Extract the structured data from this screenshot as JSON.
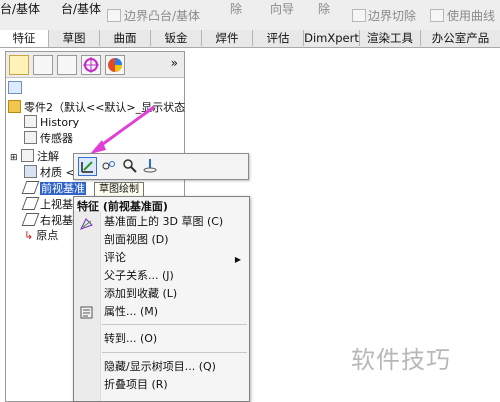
{
  "ribbon": {
    "left_text_1": "台/基体",
    "left_text_2": "台/基体",
    "boss_base": "边界凸台/基体",
    "remove_1": "除",
    "wizard": "向导",
    "remove_2": "除",
    "boundary_cut": "边界切除",
    "use_curve": "使用曲线"
  },
  "tabs": [
    {
      "label": "特征"
    },
    {
      "label": "草图"
    },
    {
      "label": "曲面"
    },
    {
      "label": "钣金"
    },
    {
      "label": "焊件"
    },
    {
      "label": "评估"
    },
    {
      "label": "DimXpert"
    },
    {
      "label": "渲染工具"
    },
    {
      "label": "办公室产品"
    }
  ],
  "panel": {
    "more": "»",
    "root": "零件2（默认<<默认>_显示状态",
    "items": [
      {
        "label": "History"
      },
      {
        "label": "传感器"
      },
      {
        "label": "注解"
      },
      {
        "label": "材质 <"
      },
      {
        "label": "前视基准"
      },
      {
        "label": "上视基"
      },
      {
        "label": "右视基"
      },
      {
        "label": "原点"
      }
    ]
  },
  "tooltip": "草图绘制",
  "menu": {
    "title": "特征 (前视基准面)",
    "items": [
      {
        "label": "基准面上的 3D 草图 (C)"
      },
      {
        "label": "剖面视图 (D)"
      },
      {
        "label": "评论"
      },
      {
        "label": "父子关系... (J)"
      },
      {
        "label": "添加到收藏 (L)"
      },
      {
        "label": "属性... (M)"
      },
      {
        "label": "转到... (O)"
      },
      {
        "label": "隐藏/显示树项目... (Q)"
      },
      {
        "label": "折叠项目 (R)"
      }
    ]
  },
  "watermark": "软件技巧",
  "colors": {
    "accent": "#2f63c8",
    "arrow": "#e040d8"
  }
}
